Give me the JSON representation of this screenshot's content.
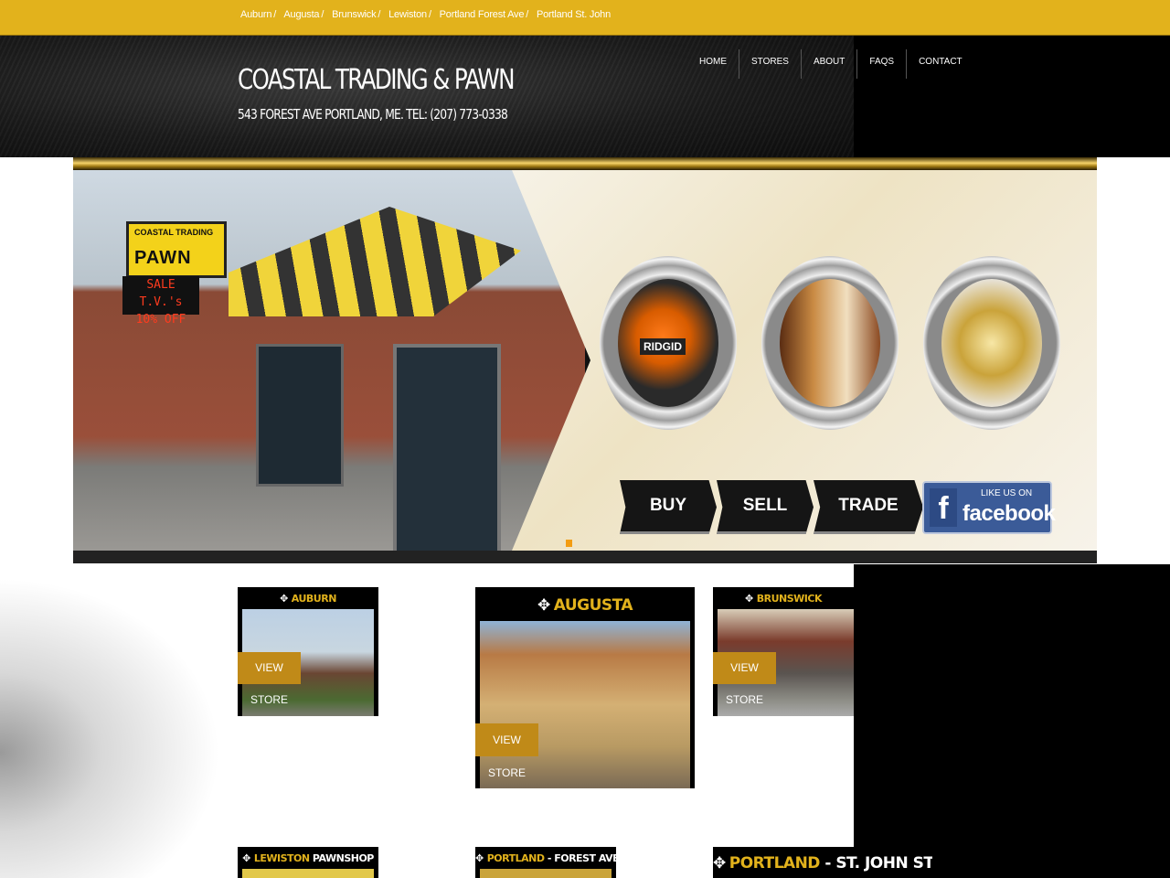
{
  "breadcrumbs": [
    {
      "label": "Auburn",
      "sep": "/"
    },
    {
      "label": "Augusta",
      "sep": "/"
    },
    {
      "label": "Brunswick",
      "sep": "/"
    },
    {
      "label": "Lewiston",
      "sep": "/"
    },
    {
      "label": "Portland Forest Ave",
      "sep": "/"
    },
    {
      "label": "Portland St. John",
      "sep": ""
    }
  ],
  "site": {
    "title": "COASTAL TRADING & PAWN",
    "subtitle": "543 FOREST AVE PORTLAND, ME. TEL: (207) 773-0338"
  },
  "nav": [
    "HOME",
    "STORES",
    "ABOUT",
    "FAQS",
    "CONTACT"
  ],
  "hero": {
    "sign_line1": "COASTAL TRADING",
    "sign_word": "PAWN",
    "led_line1": "SALE T.V.'s",
    "led_line2": "10% OFF",
    "drill_label": "RIDGID",
    "buttons": [
      "BUY",
      "SELL",
      "TRADE"
    ],
    "facebook_like": "LIKE US ON",
    "facebook_name": "facebook"
  },
  "stores": [
    {
      "name": "AUBURN",
      "cta": "VIEW STORE"
    },
    {
      "name": "AUGUSTA",
      "cta": "VIEW STORE"
    },
    {
      "name": "BRUNSWICK",
      "cta": "VIEW STORE"
    },
    {
      "name": "LEWISTON",
      "suffix": " PAWNSHOP"
    },
    {
      "name": "PORTLAND",
      "suffix": " - FOREST AVENUE"
    },
    {
      "name": "PORTLAND",
      "suffix": " - ST. JOHN STREET"
    }
  ],
  "colors": {
    "gold": "#e2b21c",
    "cta": "#c08a18",
    "dark": "#000000"
  },
  "icons": {
    "store": "diamond-cluster-icon",
    "facebook": "facebook-f-icon"
  }
}
